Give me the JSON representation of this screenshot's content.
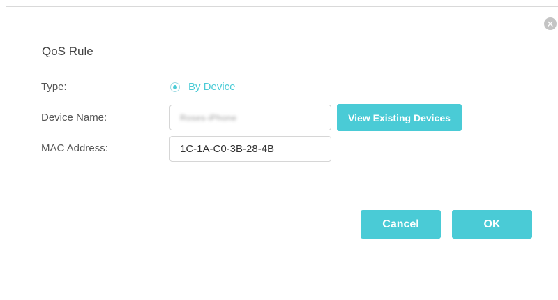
{
  "dialog": {
    "title": "QoS Rule",
    "close_icon": "close-circle-icon"
  },
  "form": {
    "type_label": "Type:",
    "type_option": "By Device",
    "type_selected": true,
    "device_name_label": "Device Name:",
    "device_name_value": "Roses-iPhone",
    "mac_label": "MAC Address:",
    "mac_value": "1C-1A-C0-3B-28-4B"
  },
  "buttons": {
    "view_devices": "View Existing Devices",
    "cancel": "Cancel",
    "ok": "OK"
  },
  "colors": {
    "accent": "#4acbd6",
    "border": "#d6d6d6",
    "text": "#555555"
  }
}
